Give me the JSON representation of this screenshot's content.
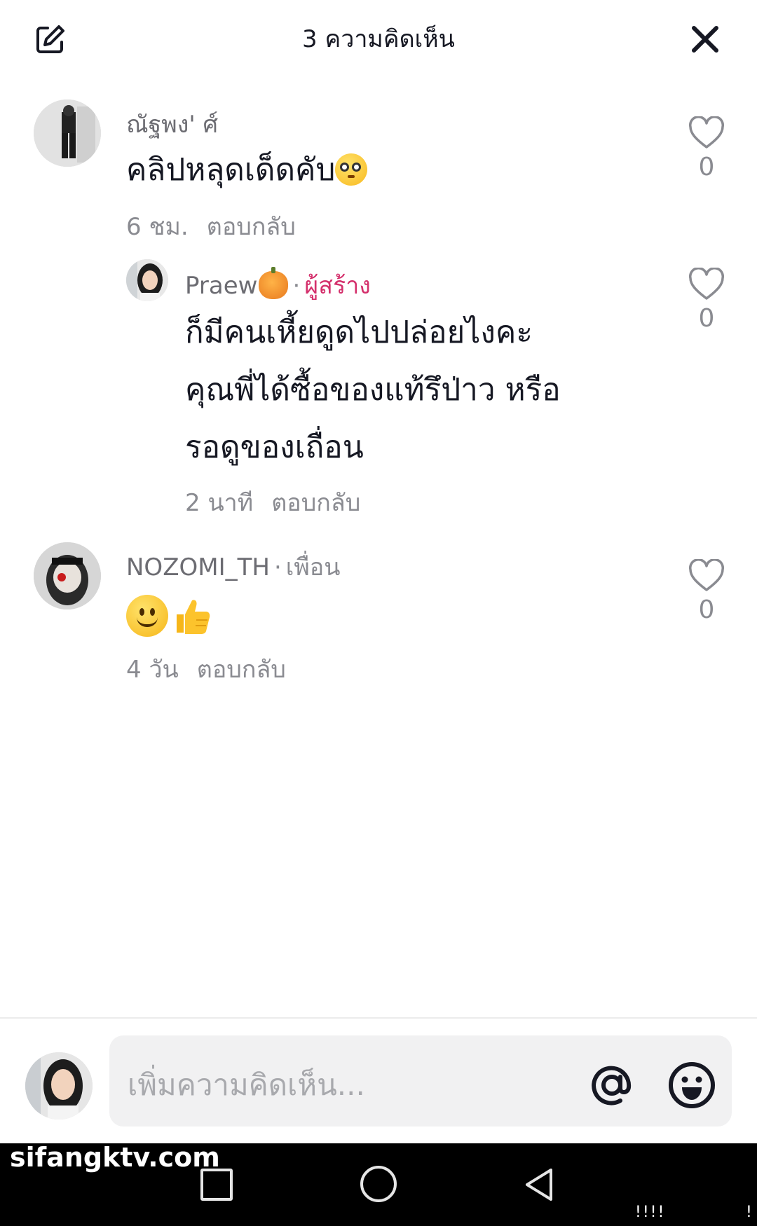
{
  "header": {
    "title": "3 ความคิดเห็น"
  },
  "comments": [
    {
      "username": "ณัฐพง' ศ์",
      "text": "คลิปหลุดเด็ดคับ",
      "emoji": "flushed-face",
      "time": "6 ชม.",
      "reply_label": "ตอบกลับ",
      "likes": "0"
    },
    {
      "username": "Praew",
      "name_emoji": "jack-o-lantern",
      "separator": "·",
      "badge": "ผู้สร้าง",
      "text_lines": [
        "ก็มีคนเหี้ยดูดไปปล่อยไงคะ",
        "คุณพี่ได้ซื้อของแท้รึป่าว หรือ",
        "รอดูของเถื่อน"
      ],
      "time": "2 นาที",
      "reply_label": "ตอบกลับ",
      "likes": "0"
    },
    {
      "username": "NOZOMI_TH",
      "separator": "·",
      "badge": "เพื่อน",
      "emojis": [
        "slightly-smiling-face",
        "thumbs-up"
      ],
      "time": "4 วัน",
      "reply_label": "ตอบกลับ",
      "likes": "0"
    }
  ],
  "composer": {
    "placeholder": "เพิ่มความคิดเห็น..."
  },
  "watermark": "sifangktv.com",
  "system_nav": {
    "indicator": "!!!!",
    "edge": "!"
  },
  "colors": {
    "creator_badge": "#d4306c",
    "muted_text": "#8a8b91",
    "input_background": "#f1f1f2"
  }
}
